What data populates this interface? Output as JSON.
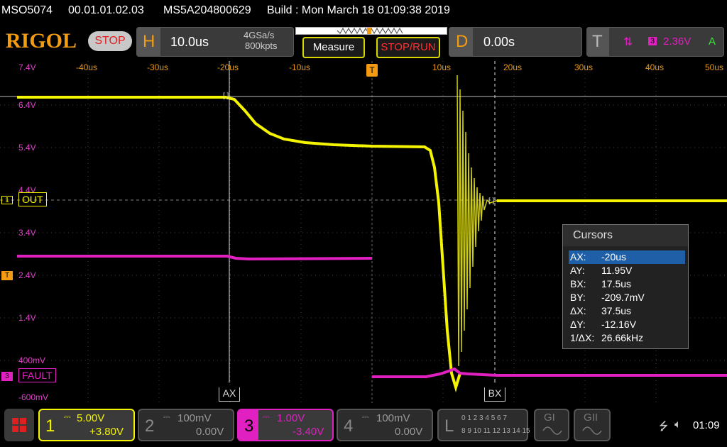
{
  "info": {
    "model": "MSO5074",
    "firmware": "00.01.01.02.03",
    "serial": "MS5A204800629",
    "build": "Build : Mon March 18 01:09:38 2019"
  },
  "toolbar": {
    "logo": "RIGOL",
    "run_state": "STOP",
    "horizontal_letter": "H",
    "timebase": "10.0us",
    "sample_rate": "4GSa/s",
    "memory_depth": "800kpts",
    "measure_label": "Measure",
    "stoprun_label": "STOP/RUN",
    "delay_letter": "D",
    "delay_value": "0.00s",
    "trigger_letter": "T",
    "trigger_source": "3",
    "trigger_level": "2.36V",
    "trigger_mode": "A"
  },
  "plot": {
    "time_ticks": [
      "-40us",
      "-30us",
      "-20us",
      "-10us",
      "10us",
      "20us",
      "30us",
      "40us",
      "50us"
    ],
    "voltage_ticks": [
      "7.4V",
      "6.4V",
      "5.4V",
      "4.4V",
      "3.4V",
      "2.4V",
      "1.4V",
      "400mV",
      "-600mV"
    ],
    "channel1_label": "OUT",
    "channel1_tag": "1",
    "channel3_label": "FAULT",
    "channel3_tag": "3",
    "trigger_tag": "T",
    "cursor_a_label": "AX",
    "cursor_b_label": "BX",
    "colors": {
      "channel1": "#f4f400",
      "channel3": "#e020c0",
      "trigger": "#f39c12"
    }
  },
  "cursors": {
    "title": "Cursors",
    "rows": [
      {
        "key": "AX:",
        "value": "-20us"
      },
      {
        "key": "AY:",
        "value": "11.95V"
      },
      {
        "key": "BX:",
        "value": "17.5us"
      },
      {
        "key": "BY:",
        "value": "-209.7mV"
      },
      {
        "key": "ΔX:",
        "value": "37.5us"
      },
      {
        "key": "ΔY:",
        "value": "-12.16V"
      },
      {
        "key": "1/ΔX:",
        "value": "26.66kHz"
      }
    ]
  },
  "channels": [
    {
      "num": "1",
      "scale": "5.00V",
      "offset": "+3.80V",
      "active": true
    },
    {
      "num": "2",
      "scale": "100mV",
      "offset": "0.00V",
      "active": false
    },
    {
      "num": "3",
      "scale": "1.00V",
      "offset": "-3.40V",
      "active": true
    },
    {
      "num": "4",
      "scale": "100mV",
      "offset": "0.00V",
      "active": false
    }
  ],
  "logic": {
    "letter": "L",
    "row1": "0 1 2 3   4 5 6 7",
    "row2": "8 9 10 11 12 13 14 15"
  },
  "generators": {
    "g1": "GI",
    "g2": "GII"
  },
  "status": {
    "clock": "01:09"
  }
}
